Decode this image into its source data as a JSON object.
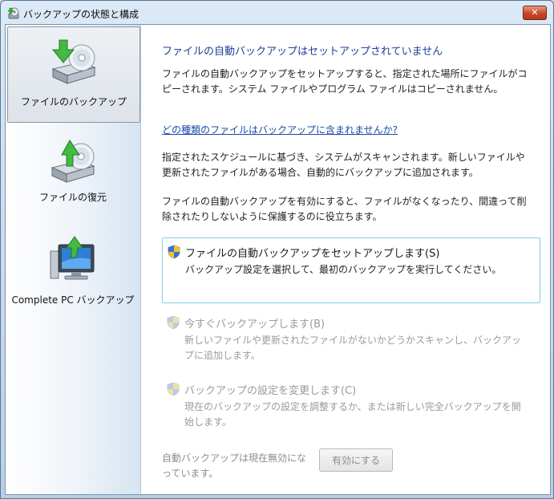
{
  "window": {
    "title": "バックアップの状態と構成",
    "close_label": "✕"
  },
  "sidebar": {
    "items": [
      {
        "label": "ファイルのバックアップ",
        "icon": "backup-files-icon",
        "selected": true
      },
      {
        "label": "ファイルの復元",
        "icon": "restore-files-icon",
        "selected": false
      },
      {
        "label": "Complete PC バックアップ",
        "icon": "complete-pc-backup-icon",
        "selected": false
      }
    ]
  },
  "main": {
    "heading": "ファイルの自動バックアップはセットアップされていません",
    "intro": "ファイルの自動バックアップをセットアップすると、指定された場所にファイルがコピーされます。システム ファイルやプログラム ファイルはコピーされません。",
    "link": "どの種類のファイルはバックアップに含まれませんか?",
    "schedule_text": "指定されたスケジュールに基づき、システムがスキャンされます。新しいファイルや更新されたファイルがある場合、自動的にバックアップに追加されます。",
    "protect_text": "ファイルの自動バックアップを有効にすると、ファイルがなくなったり、間違って削除されたりしないように保護するのに役立ちます。",
    "tasks": [
      {
        "title": "ファイルの自動バックアップをセットアップします(S)",
        "desc": "バックアップ設定を選択して、最初のバックアップを実行してください。",
        "enabled": true
      },
      {
        "title": "今すぐバックアップします(B)",
        "desc": "新しいファイルや更新されたファイルがないかどうかスキャンし、バックアップに追加します。",
        "enabled": false
      },
      {
        "title": "バックアップの設定を変更します(C)",
        "desc": "現在のバックアップの設定を調整するか、または新しい完全バックアップを開始します。",
        "enabled": false
      }
    ],
    "status_text": "自動バックアップは現在無効になっています。",
    "enable_button": "有効にする"
  },
  "colors": {
    "heading": "#1e3e9a",
    "link": "#1a4aa8",
    "task_border": "#7fd3e6",
    "disabled_text": "#9a9a9a"
  }
}
